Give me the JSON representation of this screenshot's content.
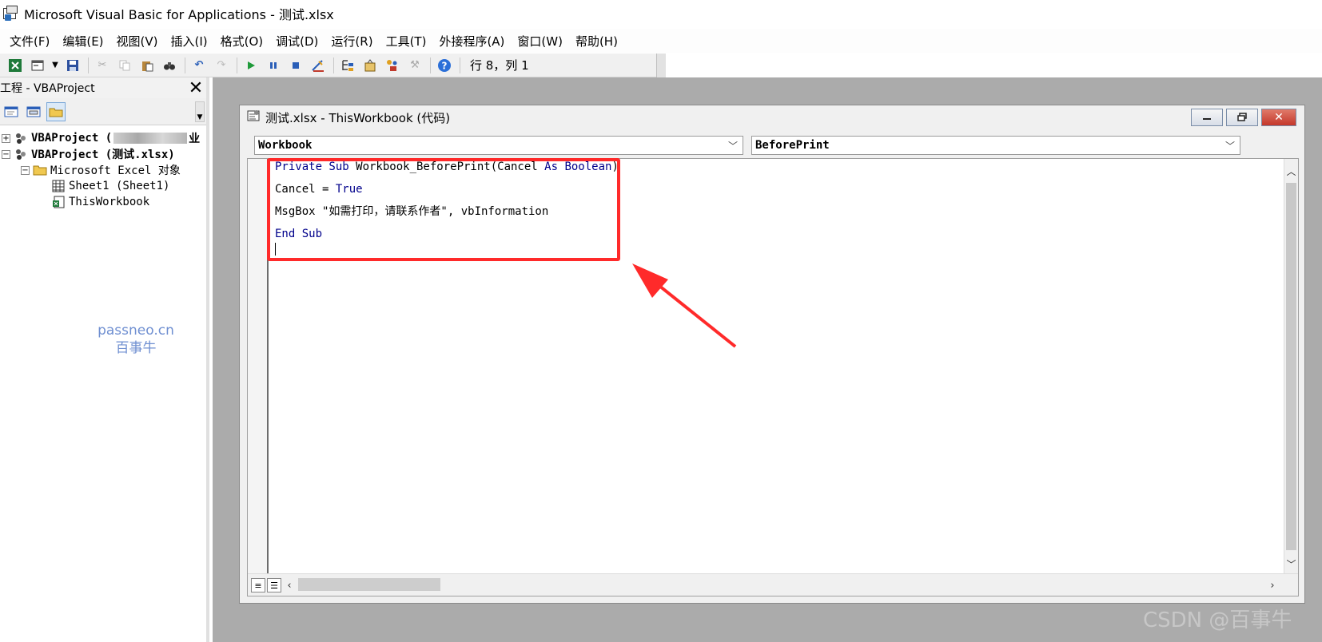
{
  "window": {
    "title": "Microsoft Visual Basic for Applications - 测试.xlsx"
  },
  "menu": [
    "文件(F)",
    "编辑(E)",
    "视图(V)",
    "插入(I)",
    "格式(O)",
    "调试(D)",
    "运行(R)",
    "工具(T)",
    "外接程序(A)",
    "窗口(W)",
    "帮助(H)"
  ],
  "toolbar": {
    "status": "行 8，列 1"
  },
  "project": {
    "title": "工程 - VBAProject",
    "close": "✕",
    "tree": {
      "node1": "VBAProject (",
      "node1_tail": "业",
      "node2": "VBAProject (测试.xlsx)",
      "folder": "Microsoft Excel 对象",
      "sheet1": "Sheet1 (Sheet1)",
      "thisworkbook": "ThisWorkbook"
    }
  },
  "watermark": {
    "line1": "passneo.cn",
    "line2": "百事牛"
  },
  "code_window": {
    "title": "测试.xlsx - ThisWorkbook (代码)",
    "object_combo": "Workbook",
    "proc_combo": "BeforePrint",
    "code": {
      "l1_kw1": "Private Sub",
      "l1_mid": " Workbook_BeforePrint(Cancel ",
      "l1_kw2": "As Boolean",
      "l1_end": ")",
      "l2_pre": "Cancel = ",
      "l2_kw": "True",
      "l3": "MsgBox \"如需打印，请联系作者\", vbInformation",
      "l4_kw": "End Sub"
    }
  },
  "colors": {
    "annotation": "#ff2a2a",
    "keyword": "#00008b",
    "watermark": "#6f8fd1"
  },
  "footer": {
    "credit": "CSDN @百事牛"
  }
}
